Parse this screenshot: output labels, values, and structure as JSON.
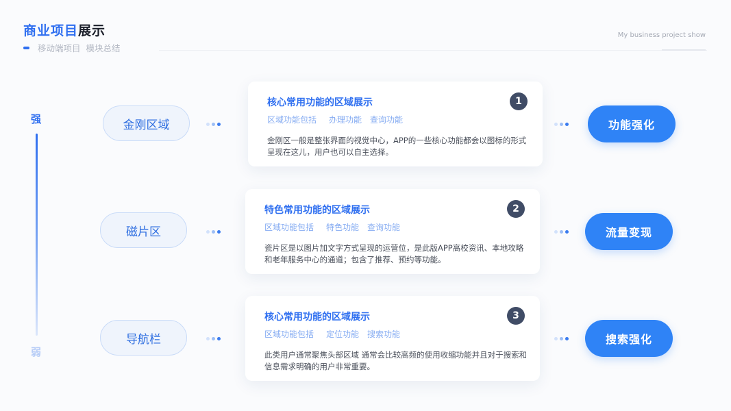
{
  "header": {
    "title_highlight": "商业项目",
    "title_rest": "展示",
    "subtitle_a": "移动端项目",
    "subtitle_b": "模块总结",
    "english_subtitle": "My business project show"
  },
  "scale": {
    "strong": "强",
    "weak": "弱"
  },
  "rows": [
    {
      "pill": "金刚区域",
      "number": "1",
      "card_title": "核心常用功能的区域展示",
      "tags": [
        "区域功能包括",
        "办理功能",
        "查询功能"
      ],
      "description": "金刚区一般是整张界面的视觉中心，APP的一些核心功能都会以图标的形式呈现在这儿，用户也可以自主选择。",
      "result": "功能强化"
    },
    {
      "pill": "磁片区",
      "number": "2",
      "card_title": "特色常用功能的区域展示",
      "tags": [
        "区域功能包括",
        "特色功能",
        "查询功能"
      ],
      "description": "瓷片区是以图片加文字方式呈现的运营位，是此版APP高校资讯、本地攻略和老年服务中心的通道；包含了推荐、预约等功能。",
      "result": "流量变现"
    },
    {
      "pill": "导航栏",
      "number": "3",
      "card_title": "核心常用功能的区域展示",
      "tags": [
        "区域功能包括",
        "定位功能",
        "搜索功能"
      ],
      "description": "此类用户通常聚焦头部区域 通常会比较高频的使用收缩功能并且对于搜索和信息需求明确的用户非常重要。",
      "result": "搜索强化"
    }
  ],
  "colors": {
    "accent": "#2f6ff0",
    "result_button": "#2f83f6",
    "number_badge": "#404c66"
  }
}
